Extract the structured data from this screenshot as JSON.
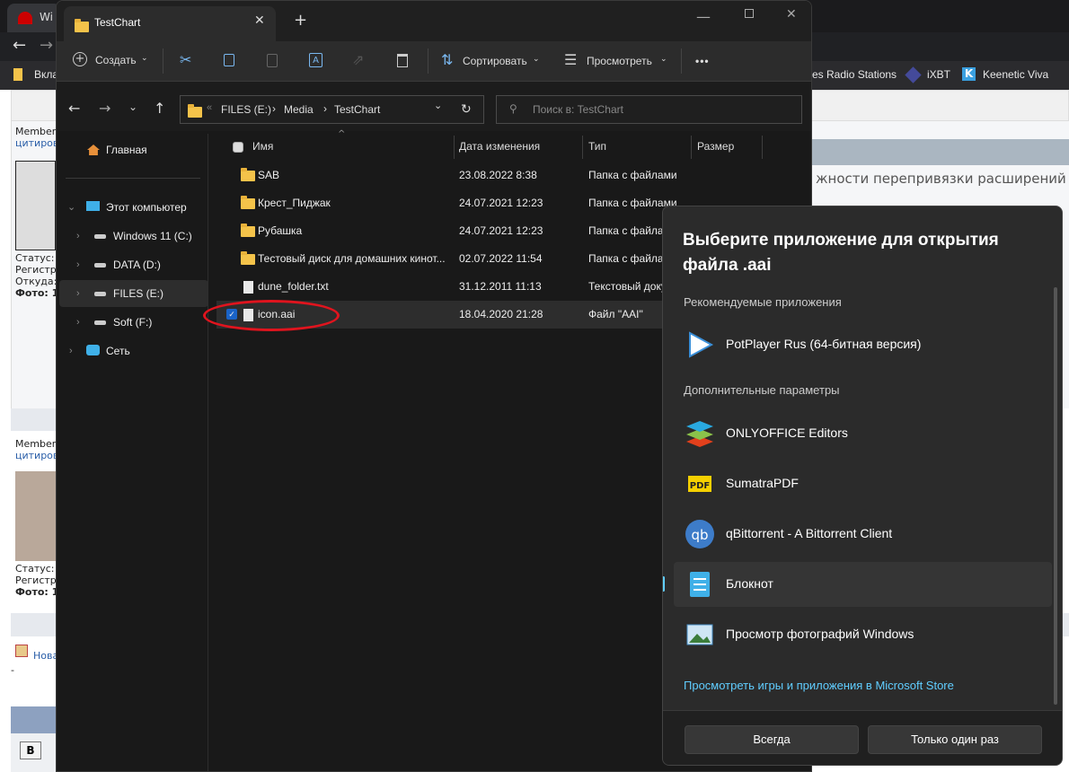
{
  "browser": {
    "tab_title": "Wi",
    "bookmarks": [
      {
        "label": "Вкла"
      },
      {
        "label": "es Radio Stations"
      },
      {
        "label": "iXBT"
      },
      {
        "label": "Keenetic Viva"
      }
    ],
    "page": {
      "member1": "Member",
      "quote1": "цитиров",
      "status1": "Статус:",
      "reg1": "Регистр",
      "from1": "Откуда:",
      "photo1": "Фото: 1",
      "member2": "Member",
      "quote2": "цитиров",
      "status2": "Статус:",
      "reg2": "Регистр",
      "photo2": "Фото: 1",
      "new_link": "Нова",
      "dash": "-",
      "bold_btn": "B",
      "topic_text": "жности перепривязки расширений .br"
    }
  },
  "explorer": {
    "tab_title": "TestChart",
    "toolbar": {
      "create": "Создать",
      "sort": "Сортировать",
      "view": "Просмотреть",
      "more": "•••"
    },
    "breadcrumb": [
      "FILES (E:)",
      "Media",
      "TestChart"
    ],
    "breadcrumb_overflow": "«",
    "search_placeholder": "Поиск в: TestChart",
    "nav": {
      "home": "Главная",
      "this_pc": "Этот компьютер",
      "drives": [
        "Windows 11 (C:)",
        "DATA (D:)",
        "FILES (E:)",
        "Soft (F:)"
      ],
      "network": "Сеть"
    },
    "columns": {
      "name": "Имя",
      "date": "Дата изменения",
      "type": "Тип",
      "size": "Размер"
    },
    "files": [
      {
        "name": "SAB",
        "date": "23.08.2022 8:38",
        "type": "Папка с файлами",
        "kind": "folder"
      },
      {
        "name": "Крест_Пиджак",
        "date": "24.07.2021 12:23",
        "type": "Папка с файлами",
        "kind": "folder"
      },
      {
        "name": "Рубашка",
        "date": "24.07.2021 12:23",
        "type": "Папка с файла",
        "kind": "folder"
      },
      {
        "name": "Тестовый диск для домашних кинот...",
        "date": "02.07.2022 11:54",
        "type": "Папка с файла",
        "kind": "folder"
      },
      {
        "name": "dune_folder.txt",
        "date": "31.12.2011 11:13",
        "type": "Текстовый доку",
        "kind": "file"
      },
      {
        "name": "icon.aai",
        "date": "18.04.2020 21:28",
        "type": "Файл \"AAI\"",
        "kind": "file",
        "selected": true
      }
    ]
  },
  "dialog": {
    "title_line1": "Выберите приложение для открытия",
    "title_line2": "файла .aai",
    "recommended_label": "Рекомендуемые приложения",
    "recommended": [
      {
        "name": "PotPlayer Rus (64-битная версия)",
        "icon": "potplayer-icon"
      }
    ],
    "more_label": "Дополнительные параметры",
    "others": [
      {
        "name": "ONLYOFFICE Editors",
        "icon": "onlyoffice-icon"
      },
      {
        "name": "SumatraPDF",
        "icon": "sumatrapdf-icon"
      },
      {
        "name": "qBittorrent - A Bittorrent Client",
        "icon": "qbittorrent-icon"
      },
      {
        "name": "Блокнот",
        "icon": "notepad-icon",
        "selected": true
      },
      {
        "name": "Просмотр фотографий Windows",
        "icon": "photo-viewer-icon"
      }
    ],
    "store_link": "Просмотреть игры и приложения в Microsoft Store",
    "always": "Всегда",
    "just_once": "Только один раз",
    "accent": "#60cdff"
  }
}
